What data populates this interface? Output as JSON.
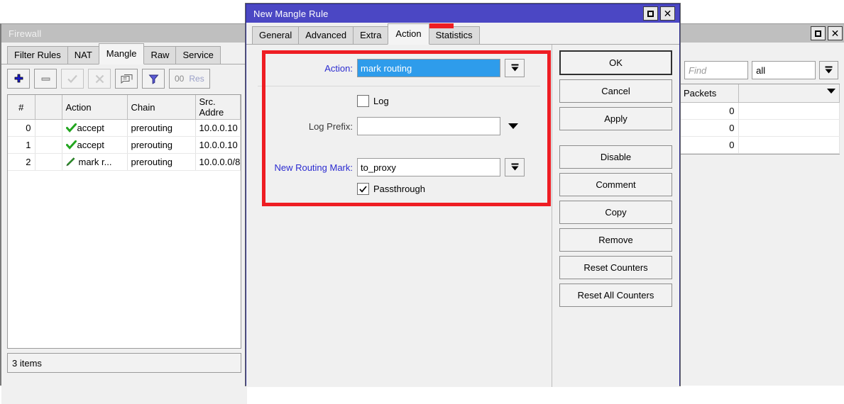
{
  "firewall_window": {
    "title": "Firewall",
    "tabs": [
      {
        "label": "Filter Rules",
        "selected": false
      },
      {
        "label": "NAT",
        "selected": false
      },
      {
        "label": "Mangle",
        "selected": true
      },
      {
        "label": "Raw",
        "selected": false
      },
      {
        "label": "Service ",
        "selected": false
      }
    ],
    "toolbar": {
      "add_icon": "plus-icon",
      "remove_icon": "minus-icon",
      "enable_icon": "check-icon",
      "disable_icon": "cross-icon",
      "comment_icon": "comment-icon",
      "filter_icon": "funnel-icon",
      "reset_counters_count": "00",
      "reset_counters_label": "Res"
    },
    "table": {
      "headers": [
        "#",
        "",
        "Action",
        "Chain",
        "Src. Addre"
      ],
      "rows": [
        {
          "num": "0",
          "flag": "",
          "action": "accept",
          "action_icon": "green-check-icon",
          "chain": "prerouting",
          "src": "10.0.0.10"
        },
        {
          "num": "1",
          "flag": "",
          "action": "accept",
          "action_icon": "green-check-icon",
          "chain": "prerouting",
          "src": "10.0.0.10"
        },
        {
          "num": "2",
          "flag": "",
          "action": "mark r...",
          "action_icon": "green-pencil-icon",
          "chain": "prerouting",
          "src": "10.0.0.0/8"
        }
      ]
    },
    "status": "3 items"
  },
  "right_window": {
    "find_placeholder": "Find",
    "filter_value": "all",
    "table": {
      "headers": [
        "Packets",
        ""
      ],
      "rows": [
        {
          "packets": "0"
        },
        {
          "packets": "0"
        },
        {
          "packets": "0"
        }
      ]
    }
  },
  "dialog": {
    "title": "New Mangle Rule",
    "tabs": [
      {
        "label": "General",
        "selected": false
      },
      {
        "label": "Advanced",
        "selected": false
      },
      {
        "label": "Extra",
        "selected": false
      },
      {
        "label": "Action",
        "selected": true
      },
      {
        "label": "Statistics",
        "selected": false
      }
    ],
    "fields": {
      "action_label": "Action:",
      "action_value": "mark routing",
      "log_label": "Log",
      "log_checked": false,
      "log_prefix_label": "Log Prefix:",
      "log_prefix_value": "",
      "new_routing_mark_label": "New Routing Mark:",
      "new_routing_mark_value": "to_proxy",
      "passthrough_label": "Passthrough",
      "passthrough_checked": true
    },
    "buttons": [
      {
        "label": "OK",
        "default": true
      },
      {
        "label": "Cancel",
        "default": false
      },
      {
        "label": "Apply",
        "default": false
      },
      {
        "label": "Disable",
        "default": false
      },
      {
        "label": "Comment",
        "default": false
      },
      {
        "label": "Copy",
        "default": false
      },
      {
        "label": "Remove",
        "default": false
      },
      {
        "label": "Reset Counters",
        "default": false
      },
      {
        "label": "Reset All Counters",
        "default": false
      }
    ]
  },
  "annotations": {
    "highlight_color": "#ee1d23",
    "accent_blue": "#2b2bd0",
    "selection_blue": "#2e9ceb",
    "titlebar_active": "#4b47c4"
  }
}
